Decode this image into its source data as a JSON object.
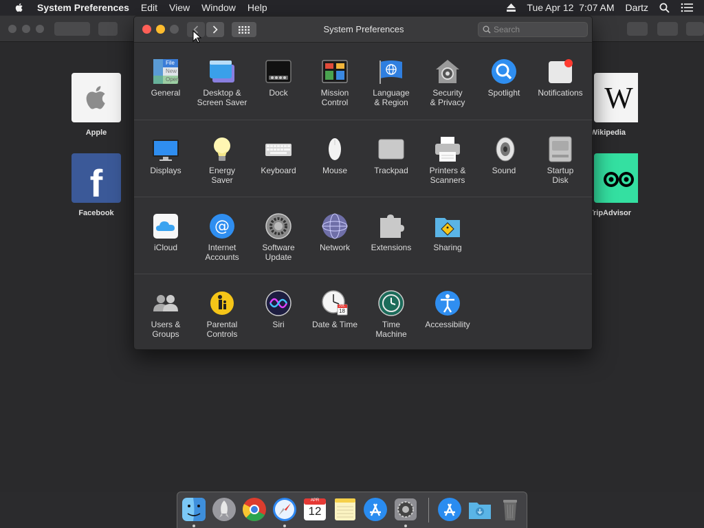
{
  "menubar": {
    "app_name": "System Preferences",
    "menus": [
      "Edit",
      "View",
      "Window",
      "Help"
    ],
    "datetime": "Tue Apr 12  7:07 AM",
    "user": "Dartz"
  },
  "favorites": [
    {
      "label": "Apple"
    },
    {
      "label": "Facebook"
    },
    {
      "label": "Wikipedia"
    },
    {
      "label": "TripAdvisor"
    }
  ],
  "window": {
    "title": "System Preferences",
    "search_placeholder": "Search"
  },
  "panes": [
    {
      "label": "General",
      "icon": "general-icon"
    },
    {
      "label": "Desktop &\nScreen Saver",
      "icon": "desktop-icon"
    },
    {
      "label": "Dock",
      "icon": "dock-icon"
    },
    {
      "label": "Mission\nControl",
      "icon": "mission-control-icon"
    },
    {
      "label": "Language\n& Region",
      "icon": "language-icon"
    },
    {
      "label": "Security\n& Privacy",
      "icon": "security-icon"
    },
    {
      "label": "Spotlight",
      "icon": "spotlight-icon"
    },
    {
      "label": "Notifications",
      "icon": "notifications-icon"
    },
    {
      "label": "Displays",
      "icon": "displays-icon"
    },
    {
      "label": "Energy\nSaver",
      "icon": "energy-icon"
    },
    {
      "label": "Keyboard",
      "icon": "keyboard-icon"
    },
    {
      "label": "Mouse",
      "icon": "mouse-icon"
    },
    {
      "label": "Trackpad",
      "icon": "trackpad-icon"
    },
    {
      "label": "Printers &\nScanners",
      "icon": "printer-icon"
    },
    {
      "label": "Sound",
      "icon": "sound-icon"
    },
    {
      "label": "Startup\nDisk",
      "icon": "startup-disk-icon"
    },
    {
      "label": "iCloud",
      "icon": "icloud-icon"
    },
    {
      "label": "Internet\nAccounts",
      "icon": "internet-accounts-icon"
    },
    {
      "label": "Software\nUpdate",
      "icon": "software-update-icon"
    },
    {
      "label": "Network",
      "icon": "network-icon"
    },
    {
      "label": "Extensions",
      "icon": "extensions-icon"
    },
    {
      "label": "Sharing",
      "icon": "sharing-icon"
    },
    {
      "label": "Users &\nGroups",
      "icon": "users-icon"
    },
    {
      "label": "Parental\nControls",
      "icon": "parental-controls-icon"
    },
    {
      "label": "Siri",
      "icon": "siri-icon"
    },
    {
      "label": "Date & Time",
      "icon": "date-time-icon"
    },
    {
      "label": "Time\nMachine",
      "icon": "time-machine-icon"
    },
    {
      "label": "Accessibility",
      "icon": "accessibility-icon"
    }
  ],
  "dock": [
    {
      "name": "Finder",
      "icon": "finder-icon"
    },
    {
      "name": "Launchpad",
      "icon": "launchpad-icon"
    },
    {
      "name": "Chrome",
      "icon": "chrome-icon"
    },
    {
      "name": "Safari",
      "icon": "safari-icon"
    },
    {
      "name": "Calendar",
      "icon": "calendar-icon",
      "month": "APR",
      "day": "12"
    },
    {
      "name": "Notes",
      "icon": "notes-icon"
    },
    {
      "name": "App Store",
      "icon": "app-store-icon"
    },
    {
      "name": "System Preferences",
      "icon": "system-preferences-icon"
    },
    {
      "name": "App Store Download",
      "icon": "app-store-icon"
    },
    {
      "name": "Downloads",
      "icon": "downloads-folder-icon"
    },
    {
      "name": "Trash",
      "icon": "trash-icon"
    }
  ],
  "mini_texts": {
    "general_file": "File",
    "general_new": "New",
    "general_open": "Open",
    "date_month": "JUL",
    "date_day": "18"
  },
  "colors": {
    "accent": "#2f7fe0",
    "close": "#ff5f57",
    "minimize": "#febc2e"
  }
}
